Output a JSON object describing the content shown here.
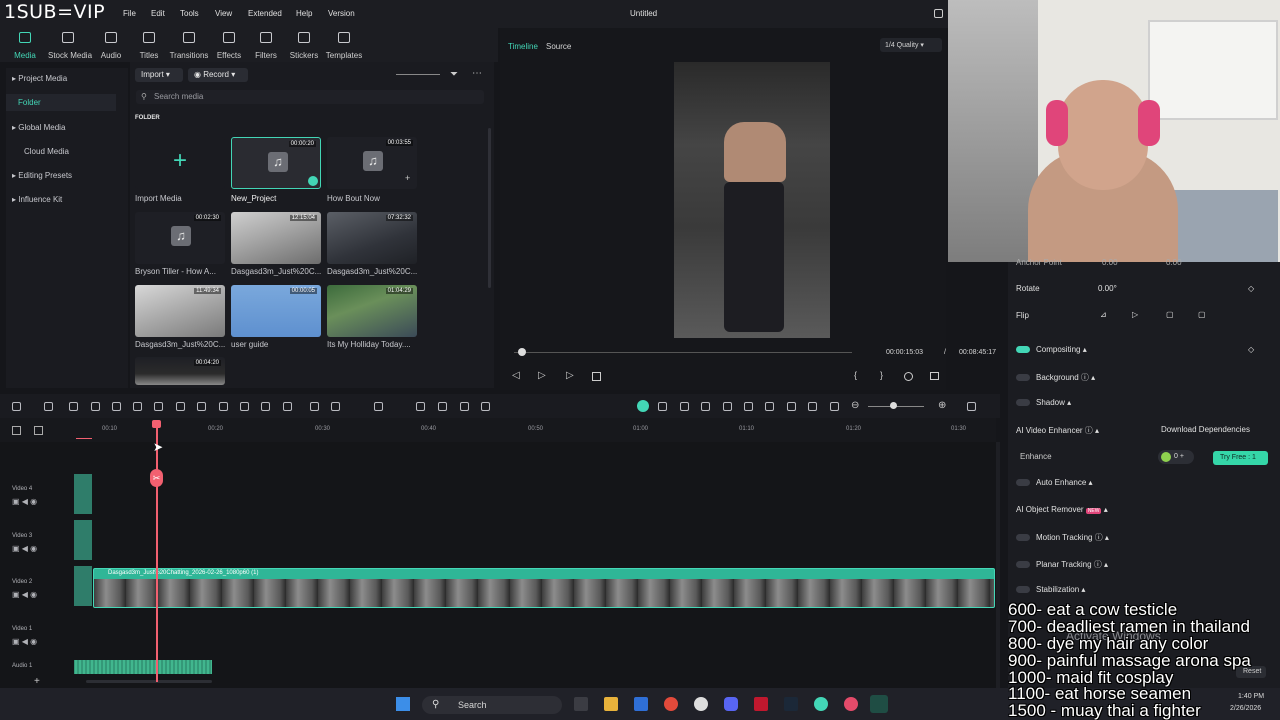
{
  "overlay_brand": "1SUB=VIP",
  "menu": [
    "File",
    "Edit",
    "Tools",
    "View",
    "Extended",
    "Help",
    "Version"
  ],
  "window_title": "Untitled",
  "toolbar": [
    "Media",
    "Stock Media",
    "Audio",
    "Titles",
    "Transitions",
    "Effects",
    "Filters",
    "Stickers",
    "Templates"
  ],
  "nav": {
    "project_media": "Project Media",
    "folder": "Folder",
    "global_media": "Global Media",
    "cloud_media": "Cloud Media",
    "editing_presets": "Editing Presets",
    "influence_kit": "Influence Kit"
  },
  "media": {
    "import_btn": "Import",
    "record_btn": "Record",
    "search_placeholder": "Search media",
    "section": "FOLDER",
    "items": [
      {
        "label": "Import Media",
        "duration": ""
      },
      {
        "label": "New_Project",
        "duration": "00:00:20"
      },
      {
        "label": "How Bout Now",
        "duration": "00:03:55"
      },
      {
        "label": "Bryson Tiller - How A...",
        "duration": "00:02:30"
      },
      {
        "label": "Dasgasd3m_Just%20C...",
        "duration": "12:15:04"
      },
      {
        "label": "Dasgasd3m_Just%20C...",
        "duration": "07:32:32"
      },
      {
        "label": "Dasgasd3m_Just%20C...",
        "duration": "11:49:34"
      },
      {
        "label": "user guide",
        "duration": "00:00:05"
      },
      {
        "label": "Its My Holliday Today....",
        "duration": "01:04:29"
      },
      {
        "label": "",
        "duration": "00:04:20"
      }
    ]
  },
  "preview": {
    "tab_timeline": "Timeline",
    "tab_source": "Source",
    "quality": "1/4 Quality",
    "current_time": "00:00:15:03",
    "separator": "/",
    "total_time": "00:08:45:17"
  },
  "props": {
    "anchor_point": "Anchor Point",
    "anchor_x": "0.00",
    "anchor_y": "0.00",
    "rotate": "Rotate",
    "rotate_value": "0.00°",
    "flip": "Flip",
    "compositing": "Compositing",
    "background": "Background",
    "shadow": "Shadow",
    "ai_video_enhancer": "AI Video Enhancer",
    "download_dependencies": "Download Dependencies",
    "enhance": "Enhance",
    "enhance_credits": "0 +",
    "try_free": "Try Free : 1",
    "auto_enhance": "Auto Enhance",
    "ai_object_remover": "AI Object Remover",
    "new_badge": "NEW",
    "motion_tracking": "Motion Tracking",
    "planar_tracking": "Planar Tracking",
    "stabilization": "Stabilization",
    "activate_windows": "Activate Windows",
    "reset": "Reset"
  },
  "ruler": [
    "00:10",
    "00:20",
    "00:30",
    "00:40",
    "00:50",
    "01:00",
    "01:10",
    "01:20",
    "01:30"
  ],
  "tracks": [
    "Video 4",
    "Video 3",
    "Video 2",
    "Video 1",
    "Audio 1"
  ],
  "clip_name": "Dasgasd3m_Just%20Chatting_2026-02-26_1080p60 (1)",
  "overlay_lines": [
    "600- eat a cow testicle",
    "700- deadliest ramen in thailand",
    "800- dye my hair any color",
    "900- painful massage arona spa",
    "1000- maid fit cosplay",
    "1100- eat horse seamen",
    "1500 - muay thai a fighter"
  ],
  "taskbar": {
    "search": "Search",
    "time": "1:40 PM",
    "date": "2/26/2026"
  }
}
